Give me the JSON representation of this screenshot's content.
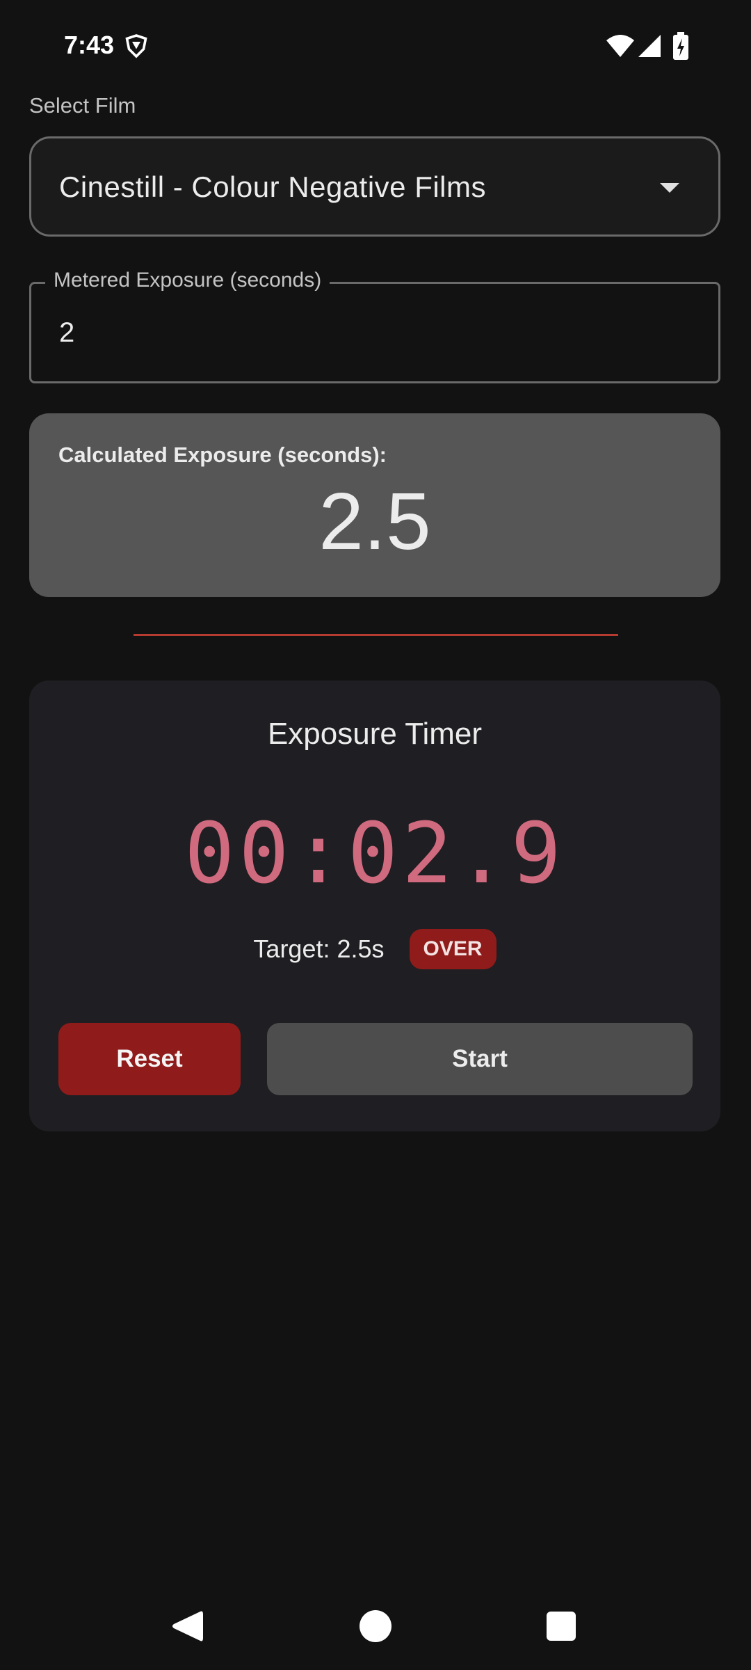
{
  "status_bar": {
    "time": "7:43",
    "icons": [
      "vpn-shield-icon",
      "wifi-icon",
      "signal-icon",
      "battery-charging-icon"
    ]
  },
  "film": {
    "label": "Select Film",
    "selected": "Cinestill - Colour Negative Films"
  },
  "metered": {
    "label": "Metered Exposure (seconds)",
    "value": "2"
  },
  "calculated": {
    "label": "Calculated Exposure (seconds):",
    "value": "2.5"
  },
  "timer": {
    "title": "Exposure Timer",
    "display": "00:02.9",
    "target": "Target: 2.5s",
    "status_badge": "OVER",
    "reset_label": "Reset",
    "start_label": "Start"
  },
  "navigation": {
    "icons": [
      "back-icon",
      "home-icon",
      "recents-icon"
    ]
  },
  "colors": {
    "background": "#121212",
    "accent_red": "#8f1c1a",
    "timer_text": "#d06a7e",
    "divider": "#b53a2f",
    "panel_gray": "#565656"
  }
}
